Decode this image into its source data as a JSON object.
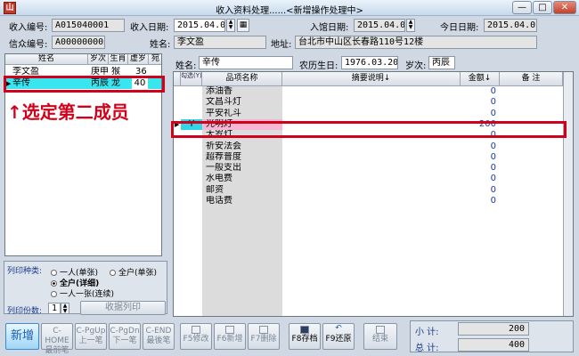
{
  "window": {
    "title": "收入资料处理......<新增操作处理中>",
    "app_icon": "山",
    "min": "—",
    "max": "□",
    "close": "✕"
  },
  "header": {
    "income_no_label": "收入编号:",
    "income_no": "A015040001",
    "income_date_label": "收入日期:",
    "income_date": "2015.04.02",
    "checkin_date_label": "入馆日期:",
    "checkin_date": "2015.04.02",
    "today_label": "今日日期:",
    "today": "2015.04.02",
    "member_no_label": "信众编号:",
    "member_no": "A000000005",
    "name_label": "姓名:",
    "name": "李文盈",
    "address_label": "地址:",
    "address": "台北市中山区长春路110号12楼"
  },
  "members": {
    "headers": [
      "姓名",
      "岁次",
      "生肖",
      "虚岁",
      "宛"
    ],
    "rows": [
      {
        "name": "李文盈",
        "year": "庚申",
        "zodiac": "猴",
        "age": "36"
      },
      {
        "name": "辛传",
        "year": "丙辰",
        "zodiac": "龙",
        "age": "40"
      }
    ]
  },
  "annotation": "↑选定第二成员",
  "person": {
    "name_label": "姓名:",
    "name": "辛传",
    "birth_label": "农历生日:",
    "birth": "1976.03.20",
    "year_label": "岁次:",
    "year": "丙辰"
  },
  "items": {
    "headers": {
      "check": "勾选(Y)",
      "name": "品项名称",
      "desc": "摘要说明↓",
      "amount": "金额↓",
      "note": "备       注"
    },
    "rows": [
      {
        "check": "",
        "name": "添油香",
        "desc": "",
        "amount": "0",
        "note": ""
      },
      {
        "check": "",
        "name": "文昌斗灯",
        "desc": "",
        "amount": "0",
        "note": ""
      },
      {
        "check": "",
        "name": "平安礼斗",
        "desc": "",
        "amount": "0",
        "note": ""
      },
      {
        "check": "Y",
        "name": "光明灯",
        "desc": "",
        "amount": "200",
        "note": ""
      },
      {
        "check": "",
        "name": "太岁灯",
        "desc": "",
        "amount": "0",
        "note": ""
      },
      {
        "check": "",
        "name": "祈安法会",
        "desc": "",
        "amount": "0",
        "note": ""
      },
      {
        "check": "",
        "name": "超荐普度",
        "desc": "",
        "amount": "0",
        "note": ""
      },
      {
        "check": "",
        "name": "一般支出",
        "desc": "",
        "amount": "0",
        "note": ""
      },
      {
        "check": "",
        "name": "水电费",
        "desc": "",
        "amount": "0",
        "note": ""
      },
      {
        "check": "",
        "name": "邮资",
        "desc": "",
        "amount": "0",
        "note": ""
      },
      {
        "check": "",
        "name": "电话费",
        "desc": "",
        "amount": "0",
        "note": ""
      }
    ]
  },
  "print": {
    "type_label": "列印种类:",
    "options": [
      "一人(单张)",
      "全户(单张)",
      "全户(详细)",
      "一人一张(连续)"
    ],
    "copies_label": "列印份数:",
    "copies": "1",
    "receipt_button": "收据列印"
  },
  "toolbar": {
    "add": "新增",
    "first": [
      "C-HOME",
      "最前笔"
    ],
    "prev": [
      "C-PgUp",
      "上一笔"
    ],
    "next": [
      "C-PgDn",
      "下一笔"
    ],
    "last": [
      "C-END",
      "最後笔"
    ],
    "edit": "F5修改",
    "new": "F6新增",
    "delete": "F7删除",
    "save": "F8存档",
    "restore": "F9还原",
    "end": "结束"
  },
  "totals": {
    "subtotal_label": "小   计:",
    "subtotal": "200",
    "total_label": "总   计:",
    "total": "400"
  }
}
